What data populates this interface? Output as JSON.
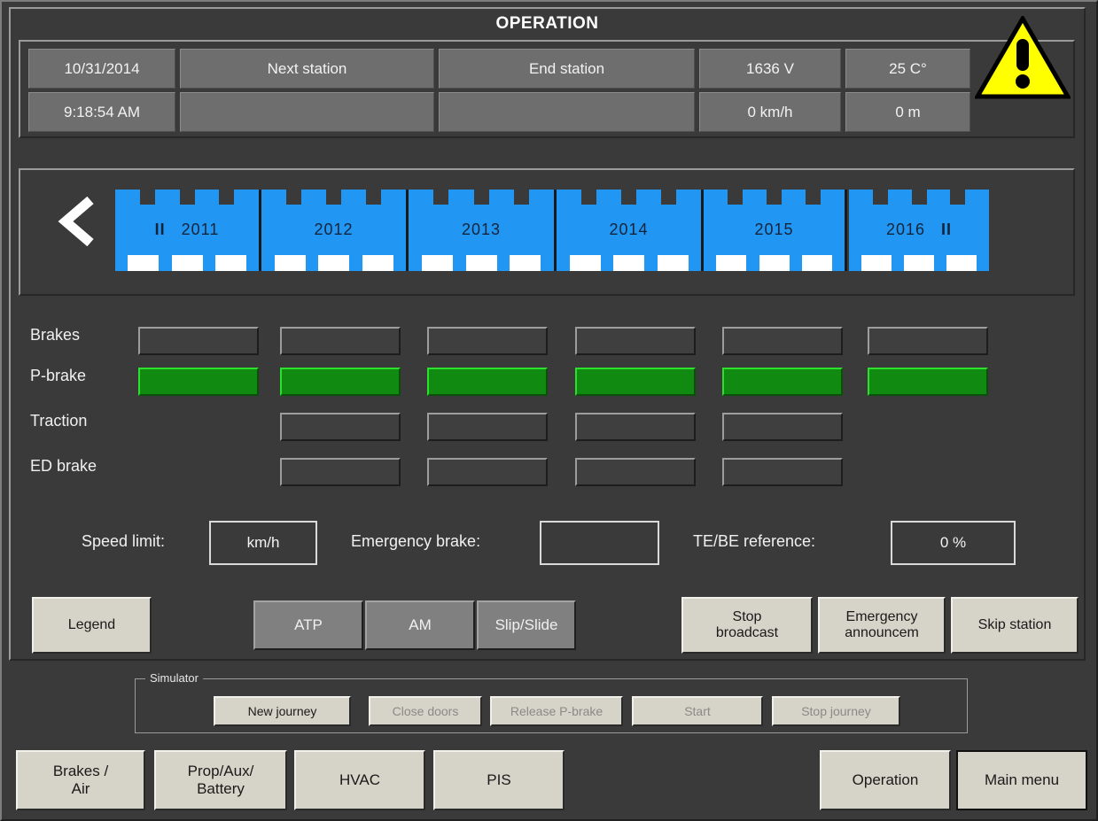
{
  "header": {
    "title": "OPERATION",
    "date": "10/31/2014",
    "time": "9:18:54 AM",
    "next_station_placeholder": "Next station",
    "end_station_placeholder": "End station",
    "next_station_value": "",
    "end_station_value": "",
    "voltage": "1636 V",
    "temperature": "25 C°",
    "speed": "0 km/h",
    "distance": "0 m",
    "warning_icon": "warning-triangle-icon"
  },
  "train": {
    "direction_icon": "left-chevron-icon",
    "front_marker": "II",
    "rear_marker": "II",
    "cars": [
      {
        "number": "2011"
      },
      {
        "number": "2012"
      },
      {
        "number": "2013"
      },
      {
        "number": "2014"
      },
      {
        "number": "2015"
      },
      {
        "number": "2016"
      }
    ]
  },
  "status_matrix": {
    "rows": [
      {
        "label": "Brakes",
        "states": [
          "off",
          "off",
          "off",
          "off",
          "off",
          "off"
        ]
      },
      {
        "label": "P-brake",
        "states": [
          "green",
          "green",
          "green",
          "green",
          "green",
          "green"
        ]
      },
      {
        "label": "Traction",
        "states": [
          "none",
          "off",
          "off",
          "off",
          "off",
          "none"
        ]
      },
      {
        "label": "ED brake",
        "states": [
          "none",
          "off",
          "off",
          "off",
          "off",
          "none"
        ]
      }
    ]
  },
  "values": {
    "speed_limit_label": "Speed limit:",
    "speed_limit_value": "km/h",
    "emergency_brake_label": "Emergency brake:",
    "emergency_brake_value": "",
    "te_be_label": "TE/BE reference:",
    "te_be_value": "0 %"
  },
  "controls": {
    "legend": "Legend",
    "atp": "ATP",
    "am": "AM",
    "slip_slide": "Slip/Slide",
    "stop_broadcast": "Stop\nbroadcast",
    "stop_broadcast_line1": "Stop",
    "stop_broadcast_line2": "broadcast",
    "emergency_announcement_line1": "Emergency",
    "emergency_announcement_line2": "announcem",
    "skip_station": "Skip station"
  },
  "simulator": {
    "legend": "Simulator",
    "buttons": [
      {
        "label": "New journey",
        "enabled": true
      },
      {
        "label": "Close doors",
        "enabled": false
      },
      {
        "label": "Release P-brake",
        "enabled": false
      },
      {
        "label": "Start",
        "enabled": false
      },
      {
        "label": "Stop journey",
        "enabled": false
      }
    ]
  },
  "nav": {
    "brakes_air_line1": "Brakes /",
    "brakes_air_line2": "Air",
    "prop_aux_line1": "Prop/Aux/",
    "prop_aux_line2": "Battery",
    "hvac": "HVAC",
    "pis": "PIS",
    "operation": "Operation",
    "main_menu": "Main menu"
  },
  "colors": {
    "panel_bg": "#3a3a3a",
    "field_bg": "#6e6e6e",
    "car_blue": "#2196f3",
    "indicator_green": "#108a10",
    "button_face": "#d6d3c8",
    "warning_yellow": "#ffff00"
  }
}
